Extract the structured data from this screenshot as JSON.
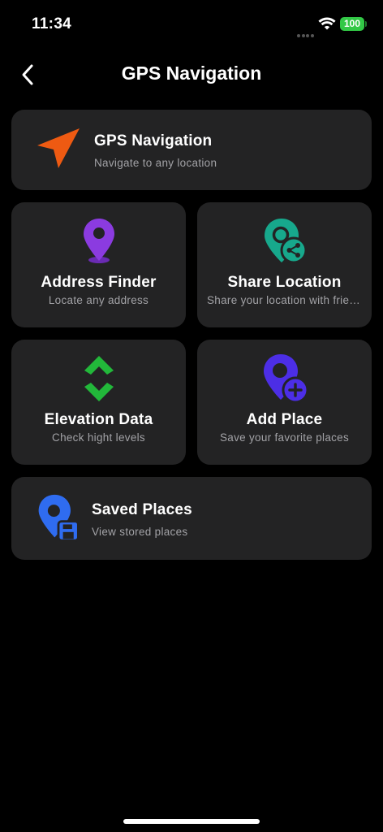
{
  "status_bar": {
    "time": "11:34",
    "battery": "100"
  },
  "header": {
    "title": "GPS Navigation",
    "back_icon": "chevron-left-icon"
  },
  "colors": {
    "background": "#000000",
    "card": "#232324",
    "nav_orange": "#ee5a12",
    "finder_purple": "#8b3be0",
    "share_teal": "#17a88c",
    "elevation_green": "#22b83a",
    "add_place_indigo": "#4c2ee6",
    "saved_blue": "#2f6cf0",
    "battery_green": "#32c846"
  },
  "cards": {
    "gps_navigation": {
      "title": "GPS Navigation",
      "subtitle": "Navigate to any location",
      "icon": "navigation-arrow-icon"
    },
    "address_finder": {
      "title": "Address Finder",
      "subtitle": "Locate any address",
      "icon": "map-pin-icon"
    },
    "share_location": {
      "title": "Share Location",
      "subtitle": "Share your location with friends",
      "icon": "share-location-icon"
    },
    "elevation_data": {
      "title": "Elevation Data",
      "subtitle": "Check hight levels",
      "icon": "up-down-chevrons-icon"
    },
    "add_place": {
      "title": "Add Place",
      "subtitle": "Save your favorite places",
      "icon": "add-location-icon"
    },
    "saved_places": {
      "title": "Saved Places",
      "subtitle": "View stored places",
      "icon": "saved-location-icon"
    }
  }
}
